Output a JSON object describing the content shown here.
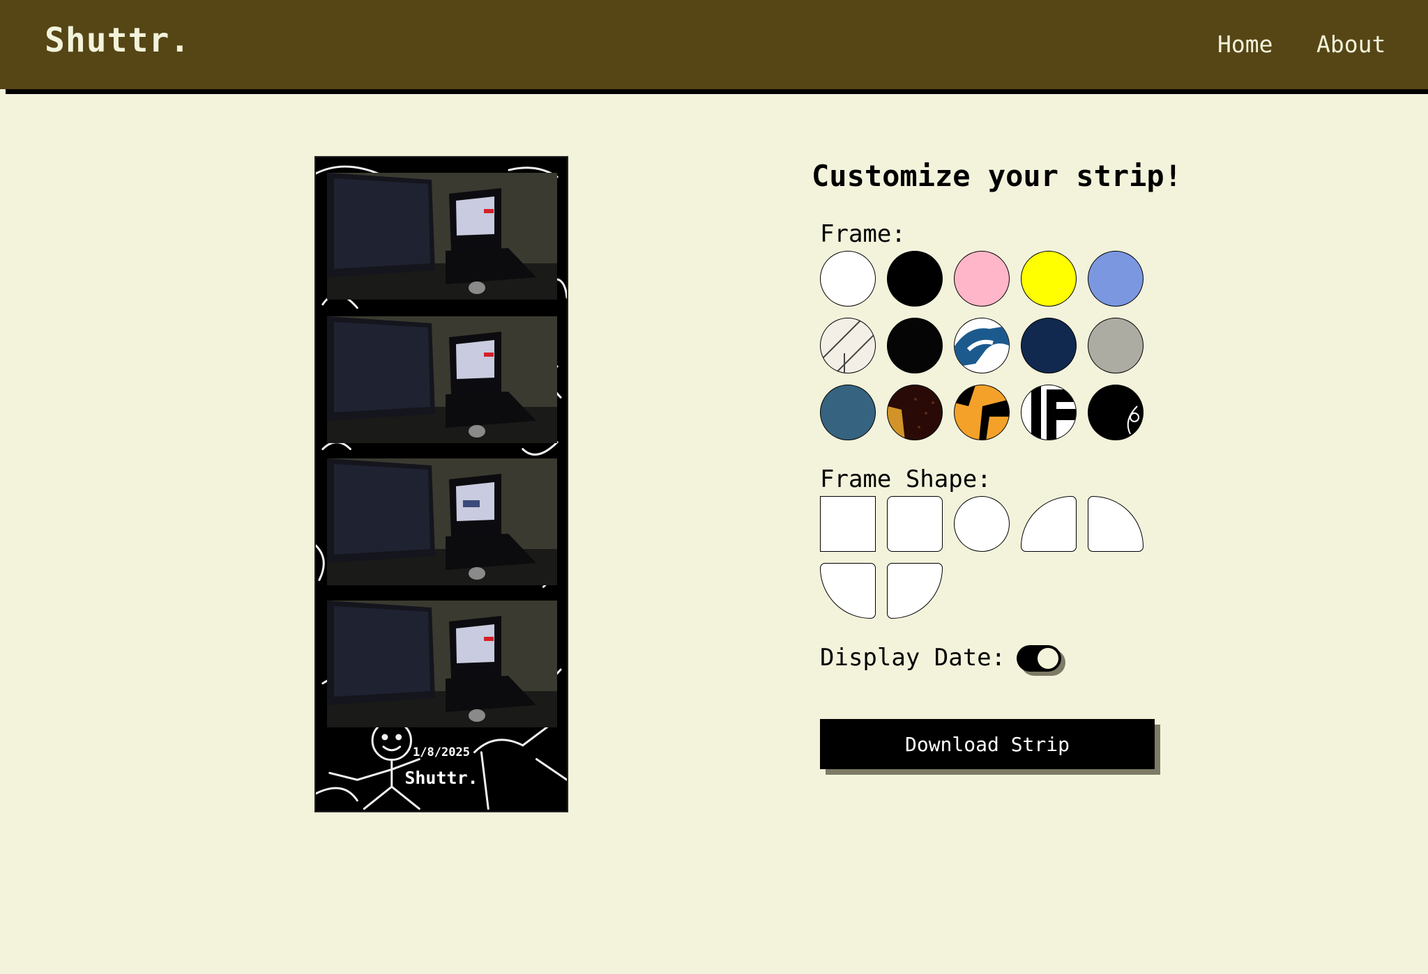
{
  "navbar": {
    "brand": "Shuttr.",
    "links": [
      {
        "label": "Home"
      },
      {
        "label": "About"
      }
    ]
  },
  "strip": {
    "date": "1/8/2025",
    "brand": "Shuttr.",
    "photo_count": 4
  },
  "panel": {
    "title": "Customize your strip!",
    "frame_label": "Frame:",
    "frame_shape_label": "Frame Shape:",
    "display_date_label": "Display Date:",
    "display_date_enabled": true,
    "download_label": "Download Strip"
  },
  "frames": [
    {
      "name": "white",
      "color": "#ffffff"
    },
    {
      "name": "black",
      "color": "#000000"
    },
    {
      "name": "pink",
      "color": "#ffb6c8"
    },
    {
      "name": "yellow",
      "color": "#ffff00"
    },
    {
      "name": "blue",
      "color": "#7a97e0"
    },
    {
      "name": "white-lines-pattern",
      "color": "#f3efe6"
    },
    {
      "name": "black-glossy",
      "color": "#050505"
    },
    {
      "name": "blue-white-pattern",
      "color": "#1c5a8e"
    },
    {
      "name": "navy",
      "color": "#11294f"
    },
    {
      "name": "gray",
      "color": "#acaca2"
    },
    {
      "name": "teal",
      "color": "#366380"
    },
    {
      "name": "dark-brown-speckle",
      "color": "#2a0a06"
    },
    {
      "name": "orange-black-pattern",
      "color": "#f4a12a"
    },
    {
      "name": "black-white-stripes",
      "color": "#000000"
    },
    {
      "name": "black-doodle",
      "color": "#000000"
    }
  ],
  "shapes": [
    {
      "name": "square"
    },
    {
      "name": "rounded-square"
    },
    {
      "name": "circle"
    },
    {
      "name": "top-left-rounded"
    },
    {
      "name": "top-right-rounded"
    },
    {
      "name": "bottom-left-rounded"
    },
    {
      "name": "bottom-right-rounded"
    }
  ],
  "colors": {
    "navbar_bg": "#564616",
    "page_bg": "#f3f3dc",
    "accent_dark": "#000000",
    "shadow": "#7d7a66"
  }
}
